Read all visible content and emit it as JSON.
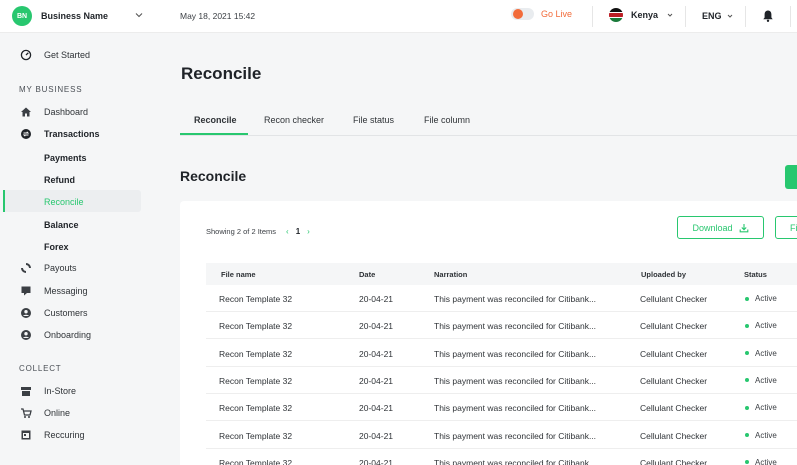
{
  "topbar": {
    "avatar_initials": "BN",
    "business_name": "Business Name",
    "datetime": "May 18, 2021 15:42",
    "go_live_label": "Go Live",
    "country": "Kenya",
    "language": "ENG"
  },
  "sidebar": {
    "get_started": "Get Started",
    "my_business_header": "MY BUSINESS",
    "dashboard": "Dashboard",
    "transactions": "Transactions",
    "payments": "Payments",
    "refund": "Refund",
    "reconcile": "Reconcile",
    "balance": "Balance",
    "forex": "Forex",
    "payouts": "Payouts",
    "messaging": "Messaging",
    "customers": "Customers",
    "onboarding": "Onboarding",
    "collect_header": "COLLECT",
    "in_store": "In-Store",
    "online": "Online",
    "recurring": "Reccuring"
  },
  "main": {
    "page_title": "Reconcile",
    "tabs": [
      "Reconcile",
      "Recon checker",
      "File status",
      "File column"
    ],
    "section_title": "Reconcile",
    "showing_text": "Showing 2 of 2 Items",
    "current_page": "1",
    "download_label": "Download",
    "file_button_label": "Fi",
    "columns": [
      "File name",
      "Date",
      "Narration",
      "Uploaded by",
      "Status"
    ],
    "rows": [
      {
        "file": "Recon Template 32",
        "date": "20-04-21",
        "narration": "This payment was reconciled for Citibank...",
        "uploaded_by": "Cellulant Checker",
        "status": "Active"
      },
      {
        "file": "Recon Template 32",
        "date": "20-04-21",
        "narration": "This payment was reconciled for Citibank...",
        "uploaded_by": "Cellulant Checker",
        "status": "Active"
      },
      {
        "file": "Recon Template 32",
        "date": "20-04-21",
        "narration": "This payment was reconciled for Citibank...",
        "uploaded_by": "Cellulant Checker",
        "status": "Active"
      },
      {
        "file": "Recon Template 32",
        "date": "20-04-21",
        "narration": "This payment was reconciled for Citibank...",
        "uploaded_by": "Cellulant Checker",
        "status": "Active"
      },
      {
        "file": "Recon Template 32",
        "date": "20-04-21",
        "narration": "This payment was reconciled for Citibank...",
        "uploaded_by": "Cellulant Checker",
        "status": "Active"
      },
      {
        "file": "Recon Template 32",
        "date": "20-04-21",
        "narration": "This payment was reconciled for Citibank...",
        "uploaded_by": "Cellulant Checker",
        "status": "Active"
      },
      {
        "file": "Recon Template 32",
        "date": "20-04-21",
        "narration": "This payment was reconciled for Citibank...",
        "uploaded_by": "Cellulant Checker",
        "status": "Active"
      }
    ]
  },
  "colors": {
    "accent": "#28c76f",
    "go_live": "#f26b3a"
  }
}
